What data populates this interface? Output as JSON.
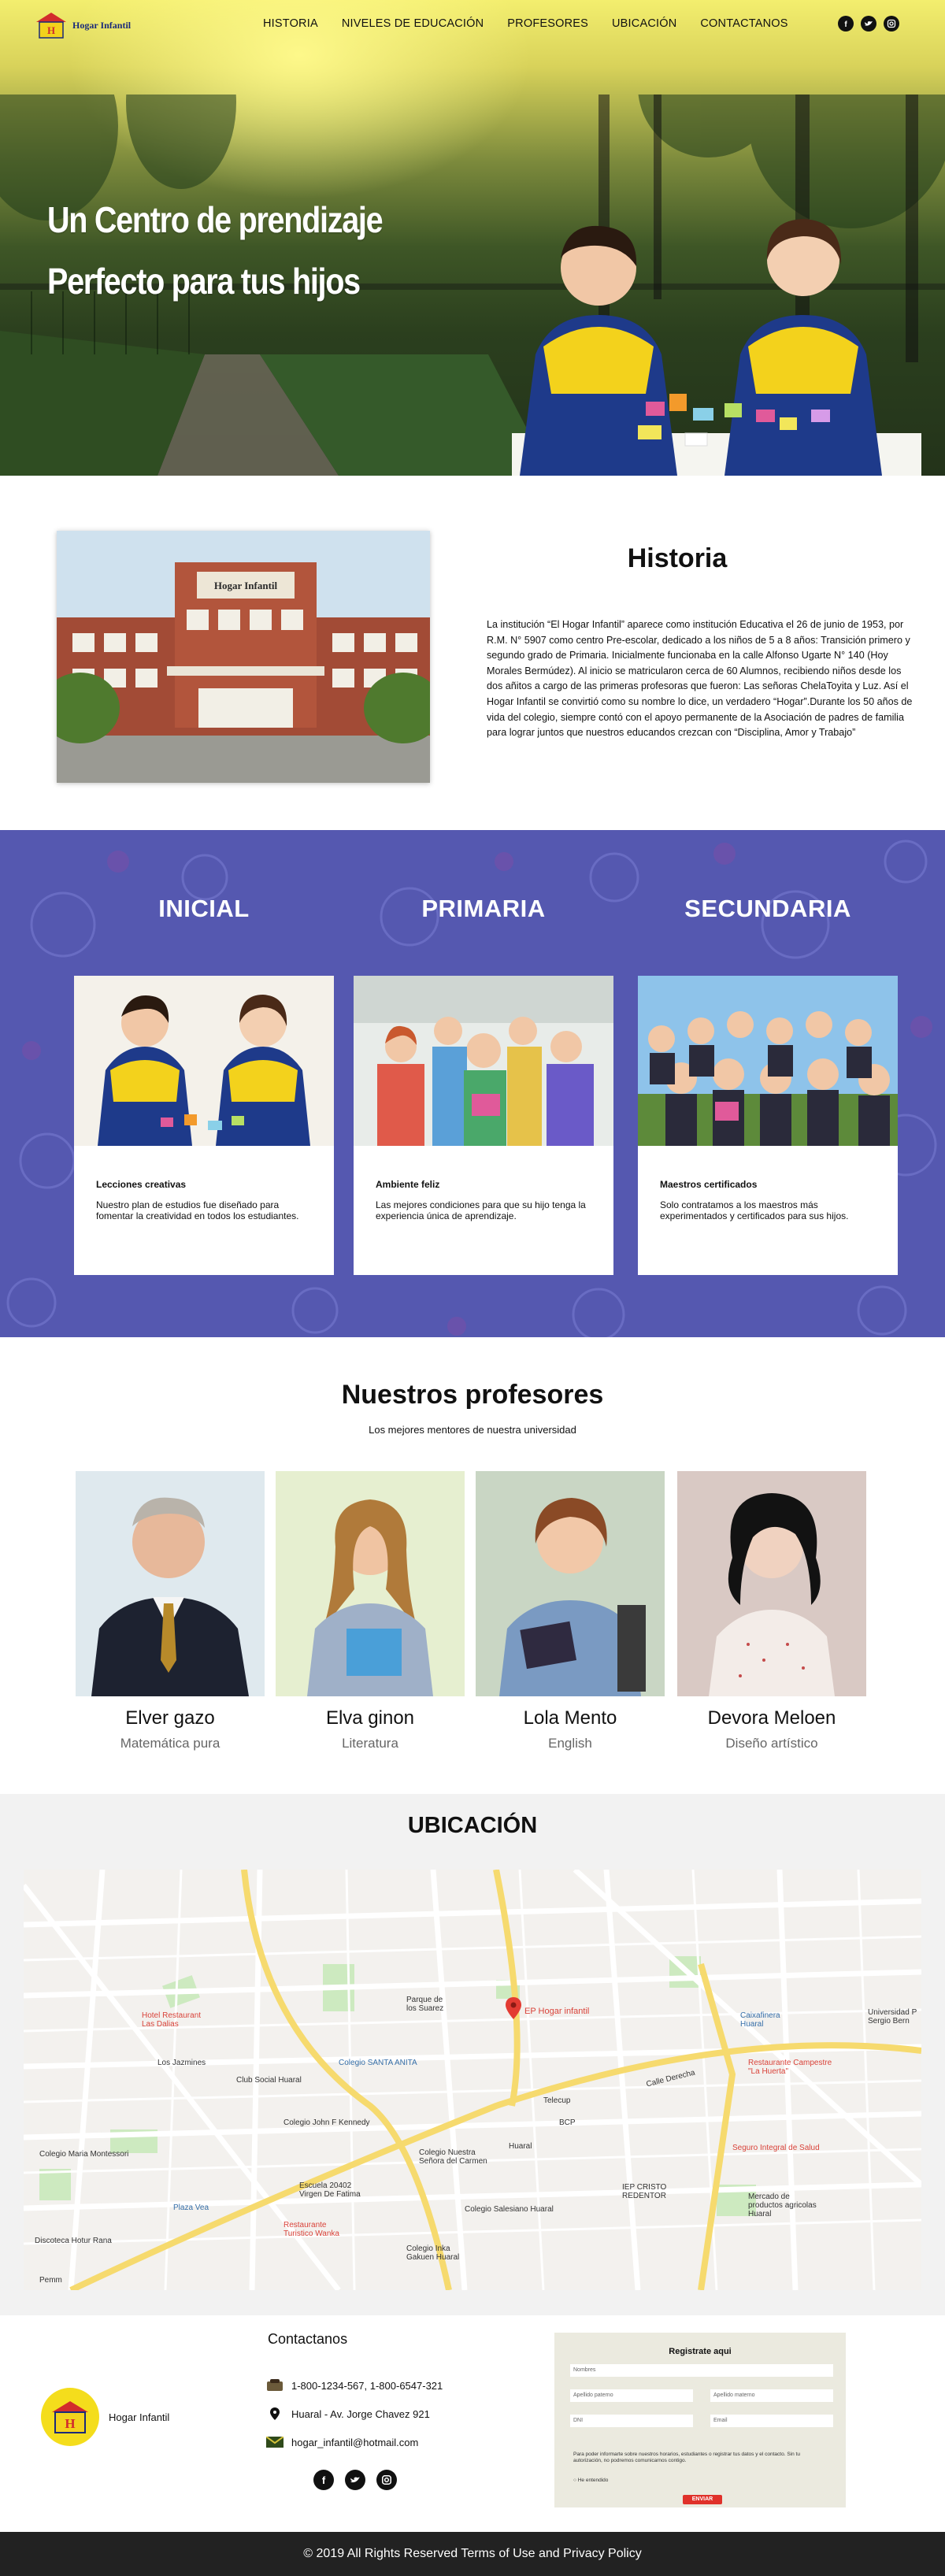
{
  "header": {
    "logo_text": "Hogar Infantil",
    "menu": [
      "HISTORIA",
      "NIVELES DE EDUCACIÓN",
      "PROFESORES",
      "UBICACIÓN",
      "CONTACTANOS"
    ],
    "social": [
      "facebook-icon",
      "twitter-icon",
      "instagram-icon"
    ]
  },
  "hero": {
    "line1": "Un Centro de prendizaje",
    "line2": "Perfecto para tus hijos"
  },
  "historia": {
    "title": "Historia",
    "photo_sign": "Hogar Infantil",
    "text": "La institución “El Hogar Infantil” aparece como institución Educativa el 26 de junio de 1953, por R.M. N° 5907 como centro Pre-escolar, dedicado a los niños de 5 a 8 años: Transición primero y segundo grado de Primaria. Inicialmente funcionaba en la calle Alfonso Ugarte N° 140 (Hoy Morales Bermúdez). Al inicio se matricularon cerca de 60 Alumnos, recibiendo niños desde los dos añitos a cargo de las primeras profesoras que fueron: Las señoras ChelaToyita y Luz. Así el Hogar Infantil se convirtió como su nombre lo dice, un verdadero “Hogar”.Durante los 50 años de vida del colegio, siempre contó con el apoyo permanente de la Asociación de padres de familia para lograr juntos que nuestros educandos crezcan con “Disciplina, Amor y Trabajo”"
  },
  "niveles": [
    {
      "title": "INICIAL",
      "card_title": "Lecciones creativas",
      "card_text": "Nuestro plan de estudios fue diseñado para fomentar la creatividad en todos los estudiantes."
    },
    {
      "title": "PRIMARIA",
      "card_title": "Ambiente feliz",
      "card_text": "Las mejores condiciones para que su hijo tenga la experiencia única de aprendizaje."
    },
    {
      "title": "SECUNDARIA",
      "card_title": "Maestros certificados",
      "card_text": "Solo contratamos a los maestros más experimentados y certificados para sus hijos."
    }
  ],
  "profesores": {
    "title": "Nuestros profesores",
    "subtitle": "Los mejores mentores de nuestra universidad",
    "items": [
      {
        "name": "Elver gazo",
        "role": "Matemática pura"
      },
      {
        "name": "Elva ginon",
        "role": "Literatura"
      },
      {
        "name": "Lola Mento",
        "role": "English"
      },
      {
        "name": "Devora Meloen",
        "role": "Diseño artístico"
      }
    ]
  },
  "ubicacion": {
    "title": "UBICACIÓN",
    "map_pin": "EP Hogar infantil",
    "labels": {
      "l1": "Hotel Restaurant\nLas Dalias",
      "l2": "Parque de\nlos Suarez",
      "l3": "Colegio SANTA ANITA",
      "l4": "Club Social Huaral",
      "l5": "Colegio John F Kennedy",
      "l6": "Colegio Nuestra\nSeñora del Carmen",
      "l7": "Escuela 20402\nVirgen De Fatima",
      "l8": "Colegio Salesiano Huaral",
      "l9": "Colegio Inka\nGakuen Huaral",
      "l10": "Restaurante\nTuristico Wanka",
      "l11": "Colegio Maria Montessori",
      "l12": "Plaza Vea",
      "l13": "Discoteca Hotur Rana",
      "l14": "Telecup",
      "l15": "BCP",
      "l16": "IEP CRISTO\nREDENTOR",
      "l17": "Caixafinera\nHuaral",
      "l18": "Restaurante Campestre\n\"La Huerta\"",
      "l19": "Seguro Integral de Salud",
      "l20": "Mercado de\nproductos agricolas\nHuaral",
      "l21": "Universidad P\nSergio Bern",
      "l22": "Calle Derecha",
      "l23": "Los Jazmines",
      "l24": "Pemm",
      "l25": "Huaral"
    }
  },
  "contacto": {
    "title": "Contactanos",
    "logo_text": "Hogar Infantil",
    "phone": "1-800-1234-567, 1-800-6547-321",
    "address": "Huaral - Av. Jorge Chavez 921",
    "email": "hogar_infantil@hotmail.com",
    "form": {
      "title": "Registrate aqui",
      "nombre": "Nombres",
      "apellido_paterno": "Apellido paterno",
      "apellido_materno": "Apellido materno",
      "dni": "DNI",
      "email": "Email",
      "notice": "Para poder informarte sobre nuestros horarios, estudiantes o registrar tus datos y el contacto. Sin tu autorización, no podremos comunicarnos contigo.",
      "check": "He entendido",
      "submit": "ENVIAR"
    }
  },
  "footer": {
    "copyright": "© 2019 All Rights Reserved Terms of Use and Privacy Policy"
  }
}
